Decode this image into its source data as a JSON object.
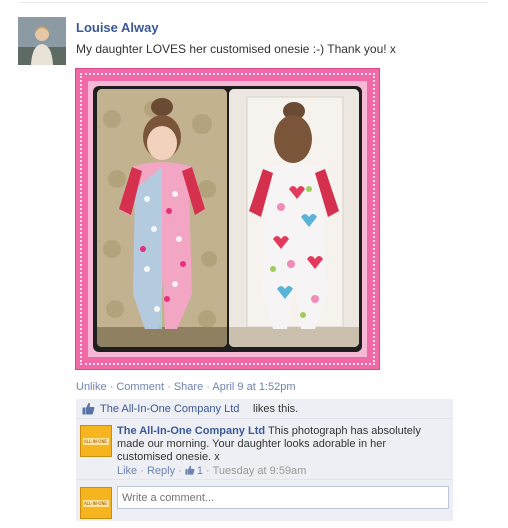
{
  "post": {
    "author": "Louise Alway",
    "text": "My daughter LOVES her customised onesie :-) Thank you! x",
    "actions": {
      "unlike": "Unlike",
      "comment": "Comment",
      "share": "Share",
      "separator": " · ",
      "timestamp": "April 9 at 1:52pm"
    }
  },
  "likes": {
    "page_name": "The All-In-One Company Ltd",
    "suffix": "likes this."
  },
  "comment": {
    "author": "The All-In-One Company Ltd",
    "text": "This photograph has absolutely made our morning. Your daughter looks adorable in her customised onesie. x",
    "like": "Like",
    "reply": "Reply",
    "like_count": "1",
    "separator": " · ",
    "timestamp": "Tuesday at 9:59am"
  },
  "reply_box": {
    "placeholder": "Write a comment..."
  },
  "icons": {
    "like": "thumbs-up-icon"
  },
  "colors": {
    "link": "#3b5998",
    "muted_link": "#6d84b4",
    "meta": "#999999",
    "ufi_background": "#edeff4",
    "frame_pink": "#f06aa8"
  }
}
